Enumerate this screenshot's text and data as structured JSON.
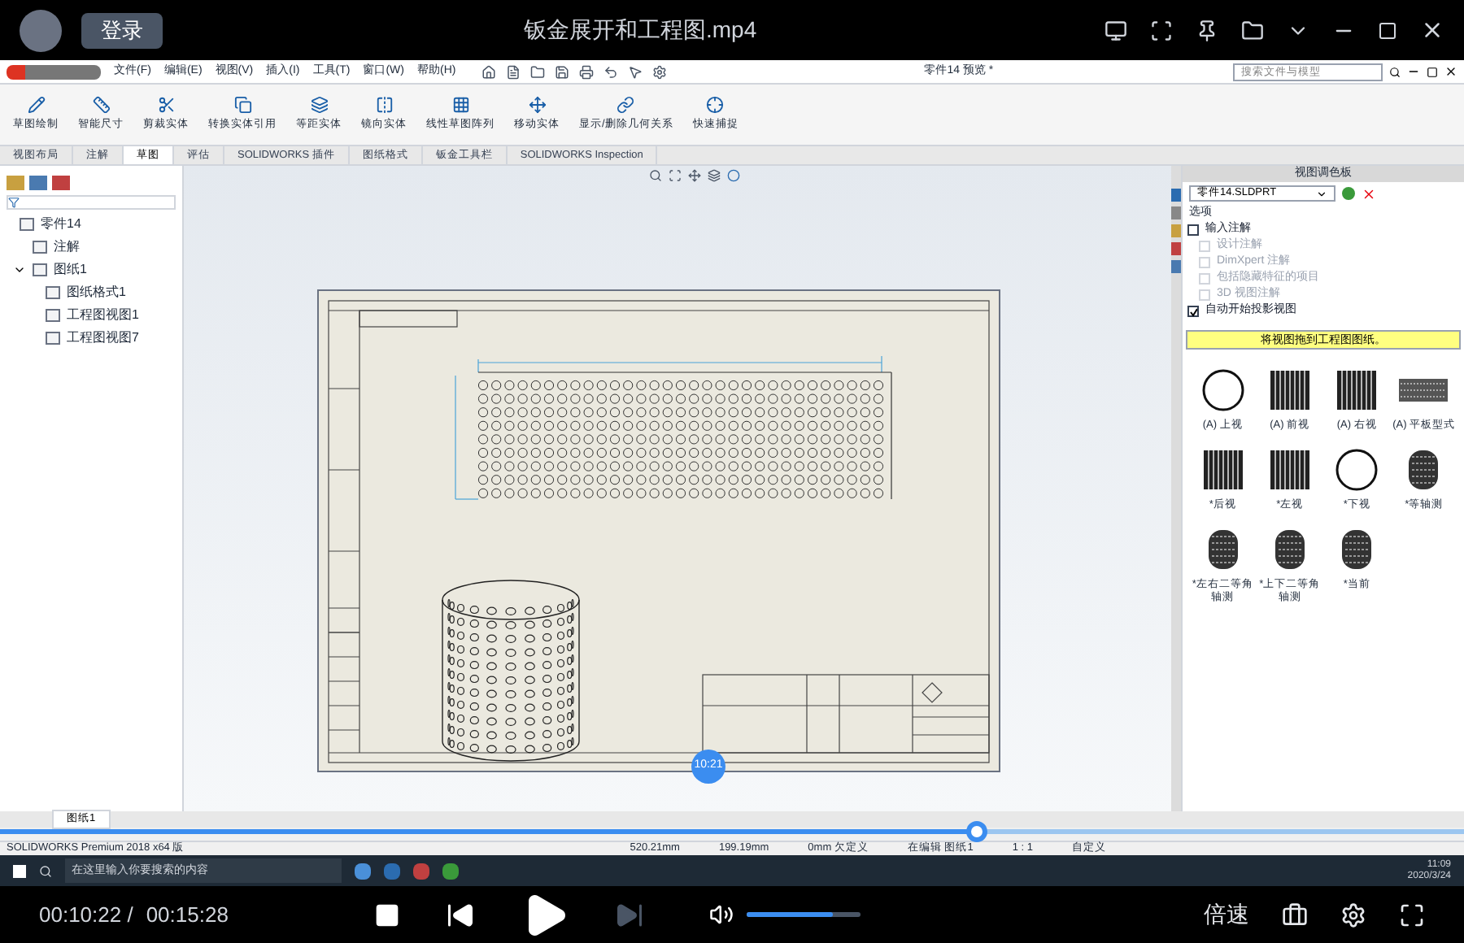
{
  "player": {
    "title": "钣金展开和工程图.mp4",
    "login": "登录",
    "current_time": "00:10:22 /",
    "total_time": "00:15:28",
    "hover_time": "10:21",
    "progress": {
      "level": 0.667
    },
    "volume": {
      "level": 0.75
    },
    "speed": "倍速",
    "next_disabled": true
  },
  "app": {
    "menus": [
      "文件(F)",
      "编辑(E)",
      "视图(V)",
      "插入(I)",
      "工具(T)",
      "窗口(W)",
      "帮助(H)"
    ],
    "document": "零件14 预览 *",
    "search": {
      "placeholder": "搜索文件与模型"
    },
    "ribbon": [
      {
        "label": "草图绘制"
      },
      {
        "label": "智能尺寸"
      },
      {
        "label": "剪裁实体"
      },
      {
        "label": "转换实体引用"
      },
      {
        "label": "等距实体"
      },
      {
        "label": "镜向实体"
      },
      {
        "label": "线性草图阵列"
      },
      {
        "label": "移动实体"
      },
      {
        "label": "显示/删除几何关系"
      },
      {
        "label": "快速捕捉"
      }
    ],
    "tabs": [
      {
        "label": "视图布局",
        "selected": false
      },
      {
        "label": "注解",
        "selected": false
      },
      {
        "label": "草图",
        "selected": true
      },
      {
        "label": "评估",
        "selected": false
      },
      {
        "label": "SOLIDWORKS 插件",
        "selected": false
      },
      {
        "label": "图纸格式",
        "selected": false
      },
      {
        "label": "钣金工具栏",
        "selected": false
      },
      {
        "label": "SOLIDWORKS Inspection",
        "selected": false
      }
    ],
    "tree": [
      {
        "label": "零件14",
        "children": [
          {
            "label": "注解"
          },
          {
            "label": "图纸1",
            "expanded": true,
            "children": [
              {
                "label": "图纸格式1"
              },
              {
                "label": "工程图视图1"
              },
              {
                "label": "工程图视图7"
              }
            ]
          }
        ]
      }
    ],
    "sheet_tab": "图纸1",
    "status_bar": [
      "SOLIDWORKS Premium 2018 x64 版",
      "520.21mm",
      "199.19mm",
      "0mm 欠定义",
      "在编辑 图纸1",
      "1 : 1",
      "自定义"
    ]
  },
  "palette": {
    "title": "视图调色板",
    "file": "零件14.SLDPRT",
    "options_label": "选项",
    "options": [
      {
        "label": "输入注解",
        "checked": false,
        "disabled": false
      },
      {
        "label": "设计注解",
        "checked": false,
        "disabled": true
      },
      {
        "label": "DimXpert 注解",
        "checked": false,
        "disabled": true
      },
      {
        "label": "包括隐藏特征的项目",
        "checked": false,
        "disabled": true
      },
      {
        "label": "3D 视图注解",
        "checked": false,
        "disabled": true
      },
      {
        "label": "自动开始投影视图",
        "checked": true,
        "disabled": false
      }
    ],
    "hint": "将视图拖到工程图图纸。",
    "views": [
      {
        "label": "(A) 上视",
        "kind": "circle"
      },
      {
        "label": "(A) 前视",
        "kind": "hatched"
      },
      {
        "label": "(A) 右视",
        "kind": "hatched"
      },
      {
        "label": "(A) 平板型式",
        "kind": "flat"
      },
      {
        "label": "*后视",
        "kind": "hatched"
      },
      {
        "label": "*左视",
        "kind": "hatched"
      },
      {
        "label": "*下视",
        "kind": "circle"
      },
      {
        "label": "*等轴测",
        "kind": "cylinder"
      },
      {
        "label": "*左右二等角轴测",
        "kind": "cylinder"
      },
      {
        "label": "*上下二等角轴测",
        "kind": "cylinder"
      },
      {
        "label": "*当前",
        "kind": "cylinder"
      }
    ]
  },
  "taskbar": {
    "search": {
      "placeholder": "在这里输入你要搜索的内容"
    },
    "time": "11:09",
    "date": "2020/3/24"
  }
}
